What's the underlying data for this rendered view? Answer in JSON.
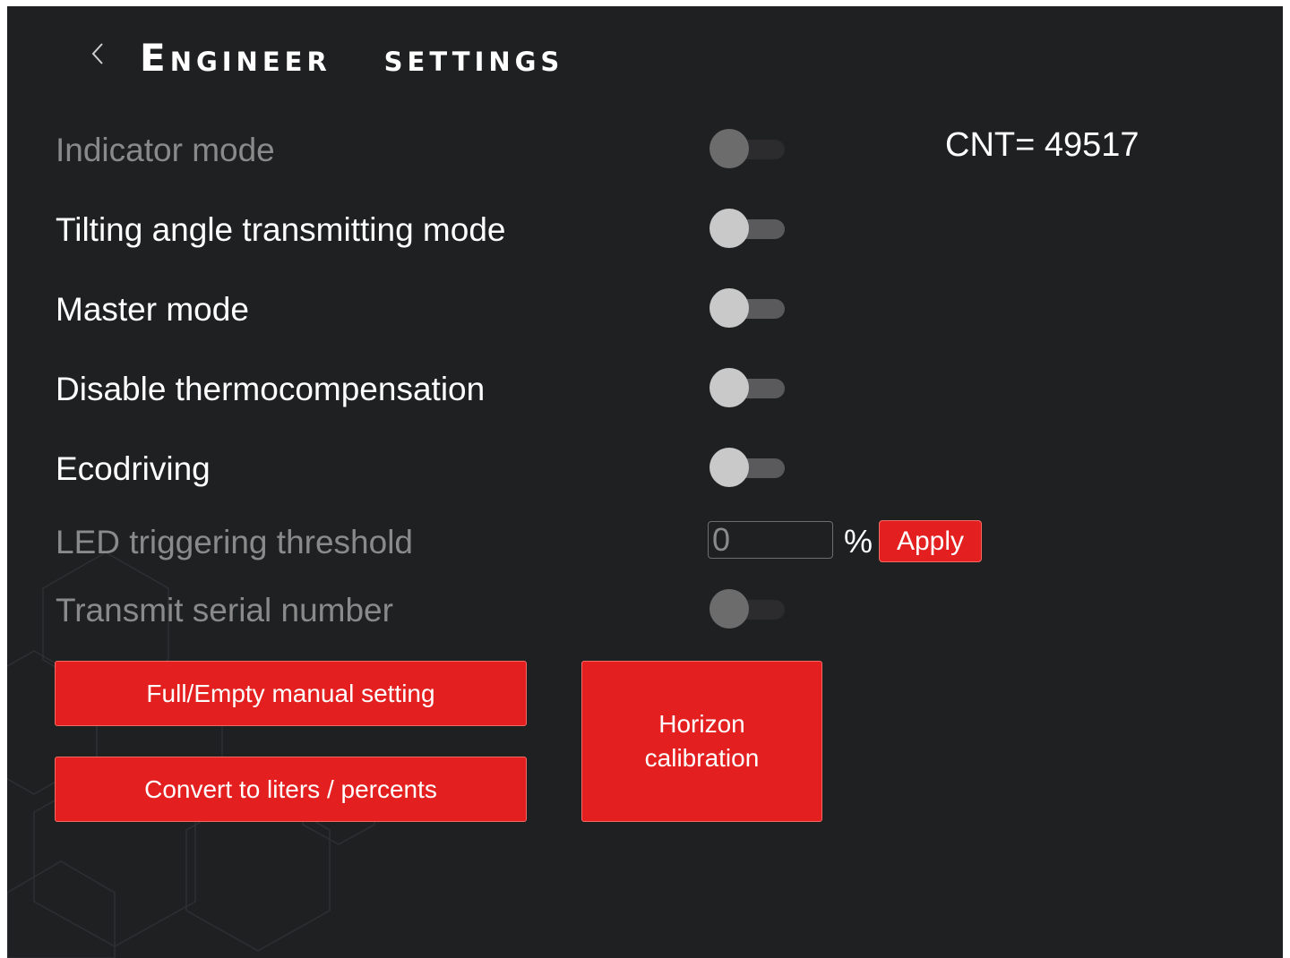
{
  "header": {
    "title": "Engineer   settings",
    "back_icon": "chevron-left-icon"
  },
  "cnt": {
    "label": "CNT= 49517"
  },
  "settings": {
    "indicator_mode": {
      "label": "Indicator mode",
      "enabled": false,
      "on": false
    },
    "tilting_angle": {
      "label": "Tilting angle transmitting mode",
      "enabled": true,
      "on": false
    },
    "master_mode": {
      "label": "Master mode",
      "enabled": true,
      "on": false
    },
    "disable_thermo": {
      "label": "Disable thermocompensation",
      "enabled": true,
      "on": false
    },
    "ecodriving": {
      "label": "Ecodriving",
      "enabled": true,
      "on": false
    },
    "led_threshold": {
      "label": "LED triggering threshold",
      "value": "0",
      "unit": "%",
      "apply_label": "Apply"
    },
    "transmit_serial": {
      "label": "Transmit serial number",
      "enabled": false,
      "on": false
    }
  },
  "buttons": {
    "full_empty": "Full/Empty manual setting",
    "convert": "Convert to liters / percents",
    "horizon": "Horizon calibration"
  },
  "colors": {
    "background": "#1f2022",
    "accent_red": "#e3201f",
    "text": "#ffffff",
    "disabled_text": "#8a8a8a"
  }
}
